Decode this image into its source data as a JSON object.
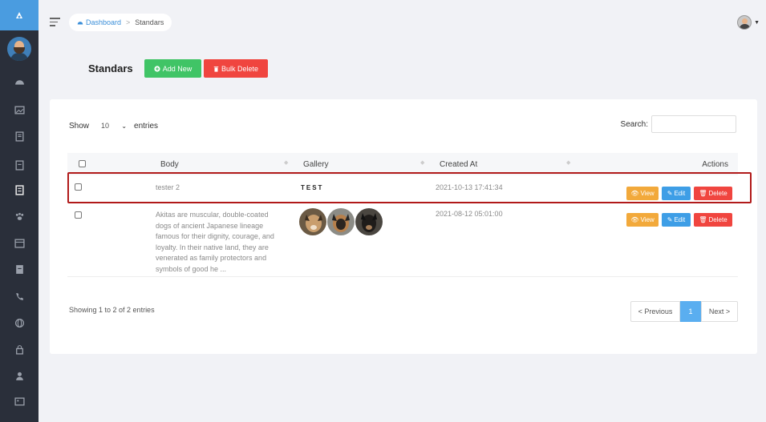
{
  "breadcrumb": {
    "home": "Dashboard",
    "separator": ">",
    "current": "Standars"
  },
  "page": {
    "title": "Standars",
    "add_label": "Add New",
    "bulk_label": "Bulk Delete"
  },
  "table_controls": {
    "show_label": "Show",
    "entries_value": "10",
    "entries_label": "entries",
    "search_label": "Search:",
    "search_value": ""
  },
  "columns": {
    "body": "Body",
    "gallery": "Gallery",
    "created_at": "Created At",
    "actions": "Actions"
  },
  "rows": [
    {
      "body": "tester 2",
      "gallery_text": "TEST",
      "created_at": "2021-10-13 17:41:34"
    },
    {
      "body": "Akitas are muscular, double-coated dogs of ancient Japanese lineage famous for their dignity, courage, and loyalty. In their native land, they are venerated as family protectors and symbols of good he ...",
      "gallery_images": [
        "dog-photo",
        "dog-photo",
        "dog-photo"
      ],
      "created_at": "2021-08-12 05:01:00"
    }
  ],
  "row_actions": {
    "view": "View",
    "edit": "Edit",
    "delete": "Delete"
  },
  "footer": {
    "info": "Showing 1 to 2 of 2 entries",
    "previous": "< Previous",
    "page": "1",
    "next": "Next >"
  },
  "colors": {
    "sidebar": "#2a2f3a",
    "add": "#40c466",
    "delete": "#f0453f",
    "view": "#f2a93b",
    "edit": "#3e9ee6",
    "highlight": "#b11a1a"
  }
}
